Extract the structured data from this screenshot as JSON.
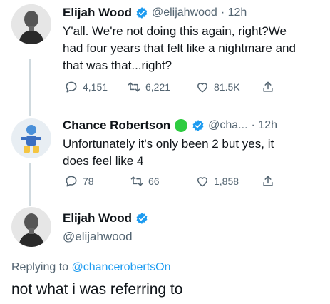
{
  "colors": {
    "text": "#0f1419",
    "muted": "#536471",
    "link": "#1d9bf0",
    "verified": "#1d9bf0",
    "thread_line": "#cfd9de",
    "status_dot": "#2ecc40"
  },
  "tweets": [
    {
      "name": "Elijah Wood",
      "verified": true,
      "handle": "@elijahwood",
      "time": "· 12h",
      "text_lines": [
        "Y'all. We're not doing this again, right?We",
        "had four years that felt like a nightmare and",
        "that was that...right?"
      ],
      "replies": "4,151",
      "retweets": "6,221",
      "likes": "81.5K",
      "icons": [
        "reply-icon",
        "retweet-icon",
        "like-icon",
        "share-icon"
      ]
    },
    {
      "name": "Chance Robertson",
      "status_icon": "green-circle-icon",
      "verified": true,
      "handle": "@cha...",
      "time": "· 12h",
      "text_lines": [
        "Unfortunately it's only been 2 but yes, it",
        "does feel like 4"
      ],
      "replies": "78",
      "retweets": "66",
      "likes": "1,858",
      "icons": [
        "reply-icon",
        "retweet-icon",
        "like-icon",
        "share-icon"
      ]
    }
  ],
  "focused_tweet": {
    "name": "Elijah Wood",
    "verified": true,
    "handle": "@elijahwood",
    "replying_prefix": "Replying to",
    "replying_to": "@chancerobertsOn",
    "text": "not what i was referring to"
  }
}
